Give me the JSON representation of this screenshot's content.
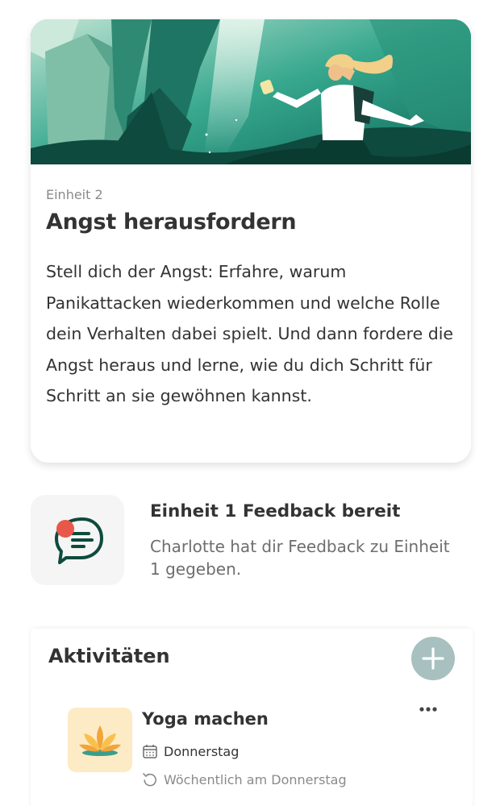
{
  "unit_card": {
    "eyebrow": "Einheit 2",
    "title": "Angst herausfordern",
    "description": "Stell dich der Angst: Erfahre, warum Panikattacken wiederkommen und welche Rolle dein Verhalten dabei spielt. Und dann fordere die Angst heraus und lerne, wie du dich Schritt für Schritt an sie gewöhnen kannst.",
    "hero_image": "woman-climbing-crystal-mountains-illustration"
  },
  "feedback": {
    "title": "Einheit 1 Feedback bereit",
    "text": "Charlotte hat dir Feedback zu Einheit 1 gegeben.",
    "icon": "chat-bubble-icon",
    "badge_color": "#e8584a"
  },
  "activities": {
    "title": "Aktivitäten",
    "add_icon": "plus-icon",
    "items": [
      {
        "name": "Yoga machen",
        "icon": "lotus-icon",
        "day": "Donnerstag",
        "recurrence": "Wöchentlich am Donnerstag"
      }
    ]
  },
  "colors": {
    "accent": "#1e8a78",
    "dark_green": "#0f4a3e",
    "add_button": "#a8c0c0",
    "activity_thumb": "#fdebc6"
  }
}
